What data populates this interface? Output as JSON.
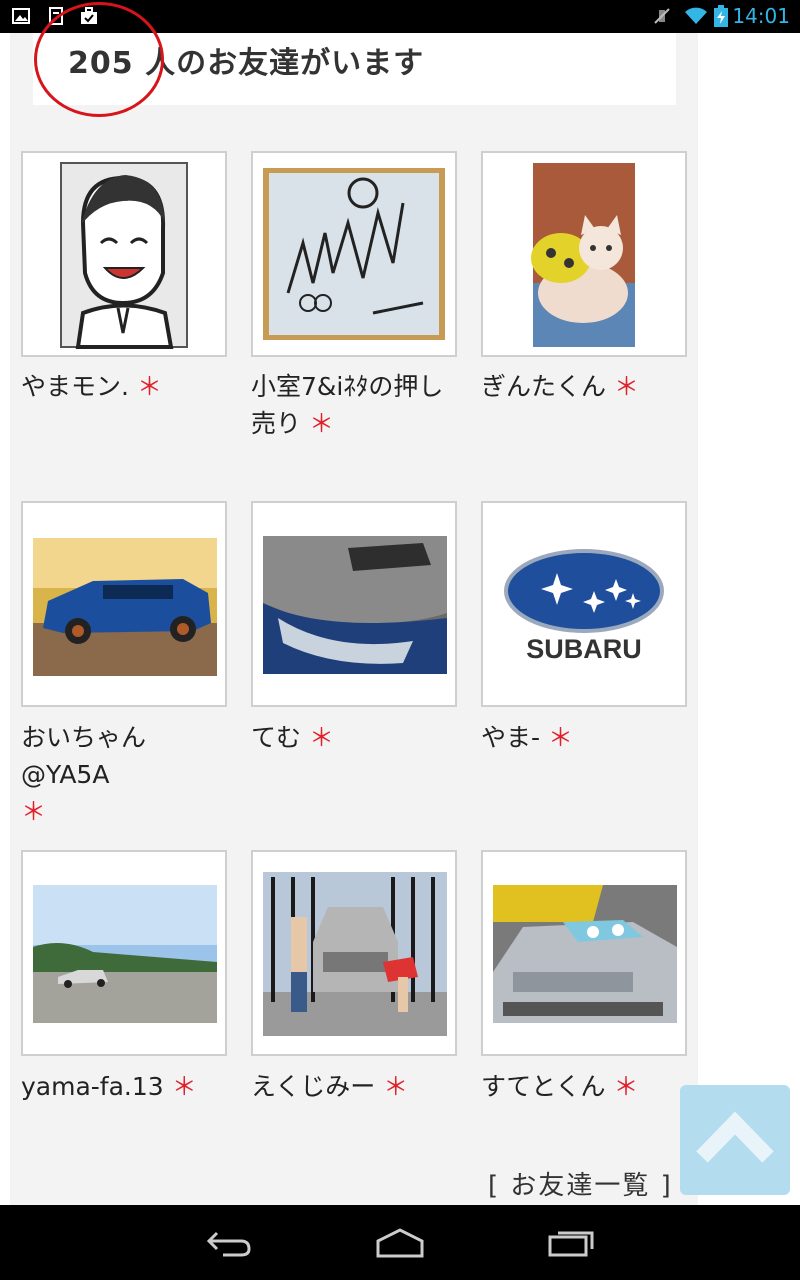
{
  "status_bar": {
    "time": "14:01"
  },
  "header": {
    "title": "205 人のお友達がいます"
  },
  "friends": [
    {
      "name": "やまモン.",
      "mark": "＊"
    },
    {
      "name": "小室7&iﾈﾀの押し売り",
      "mark": "＊"
    },
    {
      "name": "ぎんたくん",
      "mark": "＊"
    },
    {
      "name": "おいちゃん@YA5A",
      "mark": "＊"
    },
    {
      "name": "てむ",
      "mark": "＊"
    },
    {
      "name": "やま-",
      "mark": "＊"
    },
    {
      "name": "yama-fa.13",
      "mark": "＊"
    },
    {
      "name": "えくじみー",
      "mark": "＊"
    },
    {
      "name": "すてとくん",
      "mark": "＊"
    }
  ],
  "subaru_logo_text": "SUBARU",
  "footer": {
    "friends_list_link": "[ お友達一覧 ]"
  }
}
